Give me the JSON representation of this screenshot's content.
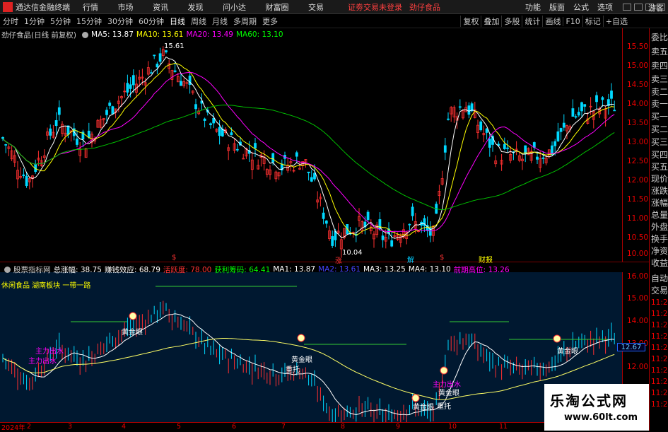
{
  "titlebar": {
    "app_title": "通达信金融终端",
    "menu": [
      "行情",
      "市场",
      "资讯",
      "发现",
      "问小达",
      "财富圈",
      "交易"
    ],
    "notice": "证劵交易未登录",
    "notice_stock": "劲仔食品",
    "right_menu": [
      "功能",
      "版面",
      "公式",
      "选项"
    ],
    "guest": "游客"
  },
  "period_tabs": [
    "分时",
    "1分钟",
    "5分钟",
    "15分钟",
    "30分钟",
    "60分钟",
    "日线",
    "周线",
    "月线",
    "多周期",
    "更多"
  ],
  "active_tab": "日线",
  "tool_tabs": [
    "复权",
    "叠加",
    "多股",
    "统计",
    "画线",
    "F10",
    "标记",
    "+自选"
  ],
  "upper": {
    "stock_label": "劲仔食品(日线 前复权)",
    "ma": [
      {
        "label": "MA5: 13.87",
        "color": "#ffffff"
      },
      {
        "label": "MA10: 13.61",
        "color": "#ffff00"
      },
      {
        "label": "MA20: 13.49",
        "color": "#ff00ff"
      },
      {
        "label": "MA60: 13.10",
        "color": "#00ff00"
      }
    ],
    "price_ticks": [
      "15.50",
      "15.00",
      "14.50",
      "14.00",
      "13.50",
      "13.00",
      "12.50",
      "12.00",
      "11.50",
      "11.00",
      "10.50",
      "10.00"
    ],
    "high_label": "15.61",
    "low_label": "10.04",
    "markers": [
      {
        "text": "$",
        "color": "#ff3030"
      },
      {
        "text": "涨",
        "color": "#ff3030"
      },
      {
        "text": "解",
        "color": "#00d0ff"
      },
      {
        "text": "$",
        "color": "#ff3030"
      },
      {
        "text": "财报",
        "color": "#ffff00"
      }
    ]
  },
  "lower": {
    "indicator_name": "股票指标网",
    "items": [
      {
        "label": "总涨幅: 38.75",
        "color": "#ffffff"
      },
      {
        "label": "赚钱效应: 68.79",
        "color": "#ffffff"
      },
      {
        "label": "活跃度: 78.00",
        "color": "#ff3030"
      },
      {
        "label": "获利筹码: 64.41",
        "color": "#00ff00"
      },
      {
        "label": "MA1: 13.87",
        "color": "#ffffff"
      },
      {
        "label": "MA2: 13.61",
        "color": "#4040ff"
      },
      {
        "label": "MA3: 13.25",
        "color": "#ffffff"
      },
      {
        "label": "MA4: 13.10",
        "color": "#ffffff"
      },
      {
        "label": "前期高位: 13.26",
        "color": "#ff00ff"
      }
    ],
    "sector_text": "休闲食品 湖南板块 一带一路",
    "ticks": [
      "16.00",
      "15.00",
      "14.00",
      "13.00",
      "12.00"
    ],
    "current_price": "12.67",
    "signals": [
      "黄金眼",
      "黄金眼",
      "黄金眼",
      "黄金眼",
      "黄金眼"
    ],
    "support": [
      "重托",
      "重托"
    ],
    "outflow": [
      "主力出水",
      "主力出水",
      "主力出水"
    ]
  },
  "side_panel": {
    "items": [
      "委比",
      "卖五",
      "卖四",
      "卖三",
      "卖二",
      "卖一",
      "买一",
      "买二",
      "买三",
      "买四",
      "买五",
      "现价",
      "涨跌",
      "涨幅",
      "总量",
      "外盘",
      "换手",
      "净资",
      "收益",
      "自动",
      "交易"
    ],
    "times": [
      "11:29",
      "11:29",
      "11:29",
      "11:29",
      "11:29",
      "11:29",
      "11:29",
      "11:29",
      "11:29",
      "11:29"
    ]
  },
  "date_axis": [
    "2024年",
    "2",
    "3",
    "4",
    "5",
    "6",
    "7",
    "8",
    "9",
    "10",
    "11"
  ],
  "ad": {
    "title": "乐淘公式网",
    "url": "www.60lt.com"
  }
}
